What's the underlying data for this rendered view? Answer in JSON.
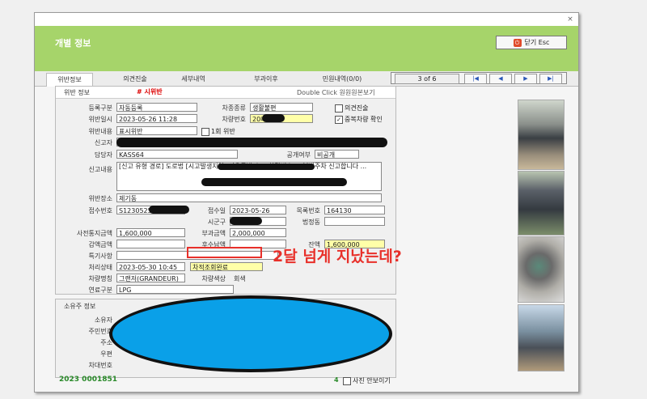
{
  "window": {
    "title": "개별 정보",
    "close_button": "닫기 Esc",
    "close_glyph": "×"
  },
  "tabs": [
    "위반정보",
    "의견진술",
    "세부내역",
    "부과이후",
    "민원내역(0/0)"
  ],
  "navigator": {
    "position": "3 of 6",
    "first": "|◀",
    "prev": "◀",
    "next": "▶",
    "last": "▶|"
  },
  "violation": {
    "section_title": "위반 정보",
    "alert": "# 시위반",
    "hint": "Double Click 원원원본보기",
    "labels": {
      "reg_type": "등록구분",
      "datetime": "위반일시",
      "content": "위반내용",
      "reporter": "신고자",
      "officer": "담당자",
      "report_content": "신고내용",
      "location": "위반장소",
      "receipt_no": "접수번호",
      "prior_amount": "사전통지금액",
      "reduced": "감액금액",
      "special": "특기사항",
      "status": "처리상태",
      "model": "차량명칭",
      "fuel": "연료구분",
      "car_type": "차종종류",
      "plate": "차량번호",
      "public": "공개여부",
      "receipt_date": "접수일",
      "district": "시군구",
      "registration_no": "목록번호",
      "legal": "법정동",
      "fine": "부과금액",
      "paid": "후수납액",
      "balance": "잔액",
      "color": "차량색상"
    },
    "values": {
      "reg_type": "자동등록",
      "datetime": "2023-05-26 11:28",
      "content": "표시위반",
      "officer": "KASS64",
      "report_content": "[신고 유형 경로] 도로법 [시고발생지역] 서울특별시 ... 차량번호 ... 불법주차 신고합니다 ...",
      "location": "제기동",
      "receipt_no": "S1230525",
      "prior_amount": "1,600,000",
      "status": "2023-05-30 10:45",
      "status_badge": "차적조회완료",
      "model": "그랜저(GRANDEUR)",
      "fuel": "LPG",
      "car_type": "생활불편",
      "plate": "20나",
      "public": "비공개",
      "receipt_date": "2023-05-26",
      "registration_no": "164130",
      "fine": "2,000,000",
      "balance": "1,600,000",
      "color": "회색"
    },
    "checkbox_opinion": "의견진술",
    "checkbox_repeat": "중복차량 확인",
    "checkbox_one": "1회 위반",
    "check_mark": "✓"
  },
  "annotation": "2달 넘게 지났는데?",
  "owner": {
    "section_title": "소유주 정보",
    "labels": [
      "소유자",
      "주민번호",
      "주소",
      "우편",
      "차대번호"
    ]
  },
  "footer": {
    "record_no": "2023  0001851",
    "count": "4",
    "photo_toggle": "사진 안보이기"
  },
  "colors": {
    "header_green": "#a6d46a",
    "annotation_red": "#e8302a",
    "redact_blue": "#0aa0e8"
  }
}
